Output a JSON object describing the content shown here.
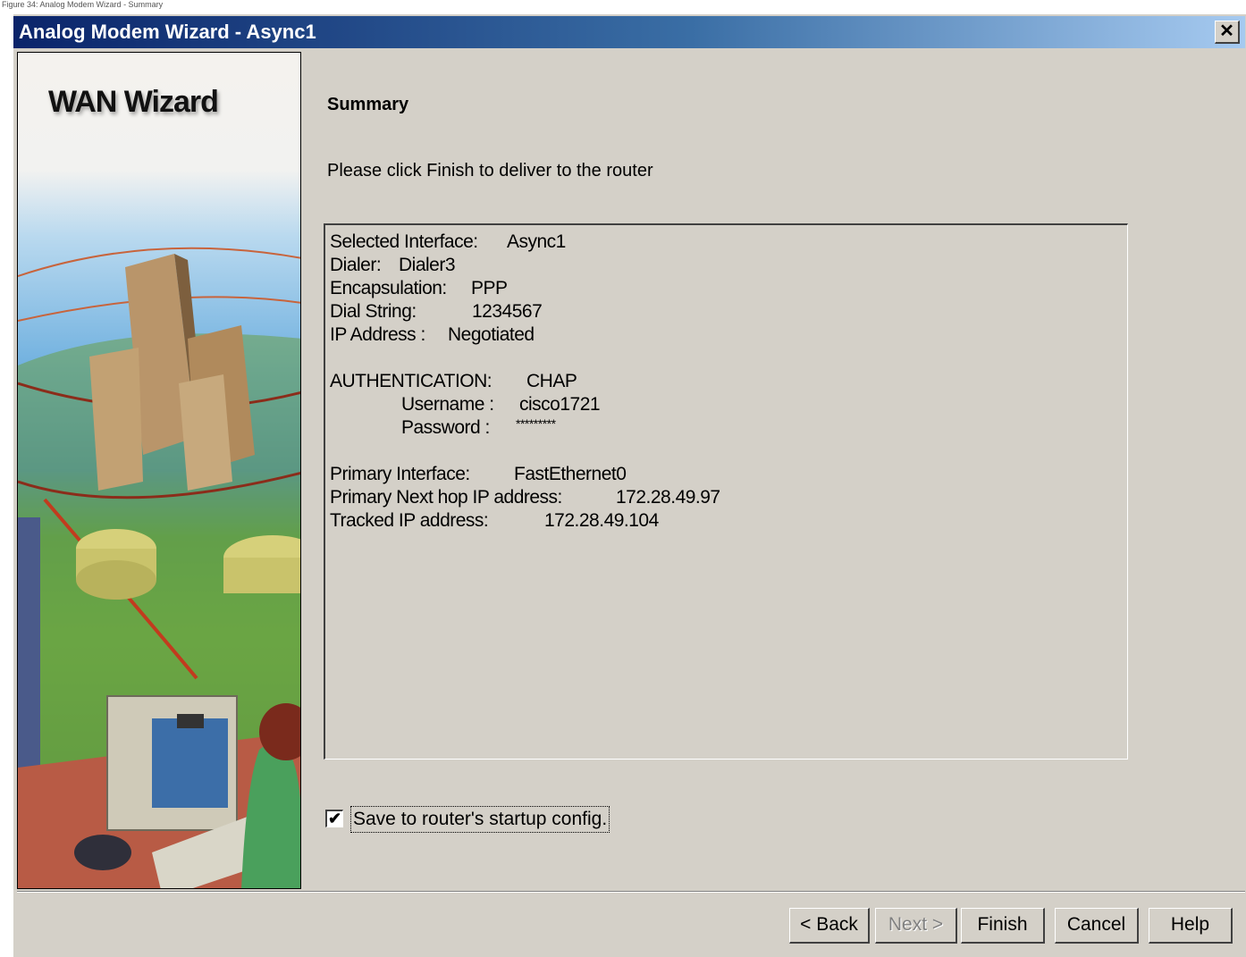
{
  "caption": "Figure 34: Analog Modem Wizard - Summary",
  "window": {
    "title": "Analog Modem Wizard - Async1",
    "close_glyph": "✕"
  },
  "side_panel": {
    "title": "WAN Wizard"
  },
  "content": {
    "title": "Summary",
    "instruction": "Please click Finish to deliver to the router"
  },
  "summary": {
    "selected_interface_label": "Selected Interface:",
    "selected_interface_value": "Async1",
    "dialer_label": "Dialer:",
    "dialer_value": "Dialer3",
    "encapsulation_label": "Encapsulation:",
    "encapsulation_value": "PPP",
    "dial_string_label": "Dial String:",
    "dial_string_value": "1234567",
    "ip_address_label": "IP Address :",
    "ip_address_value": "Negotiated",
    "authentication_label": "AUTHENTICATION:",
    "authentication_value": "CHAP",
    "username_label": "Username :",
    "username_value": "cisco1721",
    "password_label": "Password :",
    "password_value": "*********",
    "primary_interface_label": "Primary Interface:",
    "primary_interface_value": "FastEthernet0",
    "primary_next_hop_label": "Primary Next hop IP address:",
    "primary_next_hop_value": "172.28.49.97",
    "tracked_ip_label": "Tracked IP address:",
    "tracked_ip_value": "172.28.49.104"
  },
  "save_option": {
    "label": "Save to router's startup config.",
    "checked": true,
    "check_glyph": "✔"
  },
  "buttons": {
    "back": "< Back",
    "next": "Next >",
    "finish": "Finish",
    "cancel": "Cancel",
    "help": "Help"
  }
}
